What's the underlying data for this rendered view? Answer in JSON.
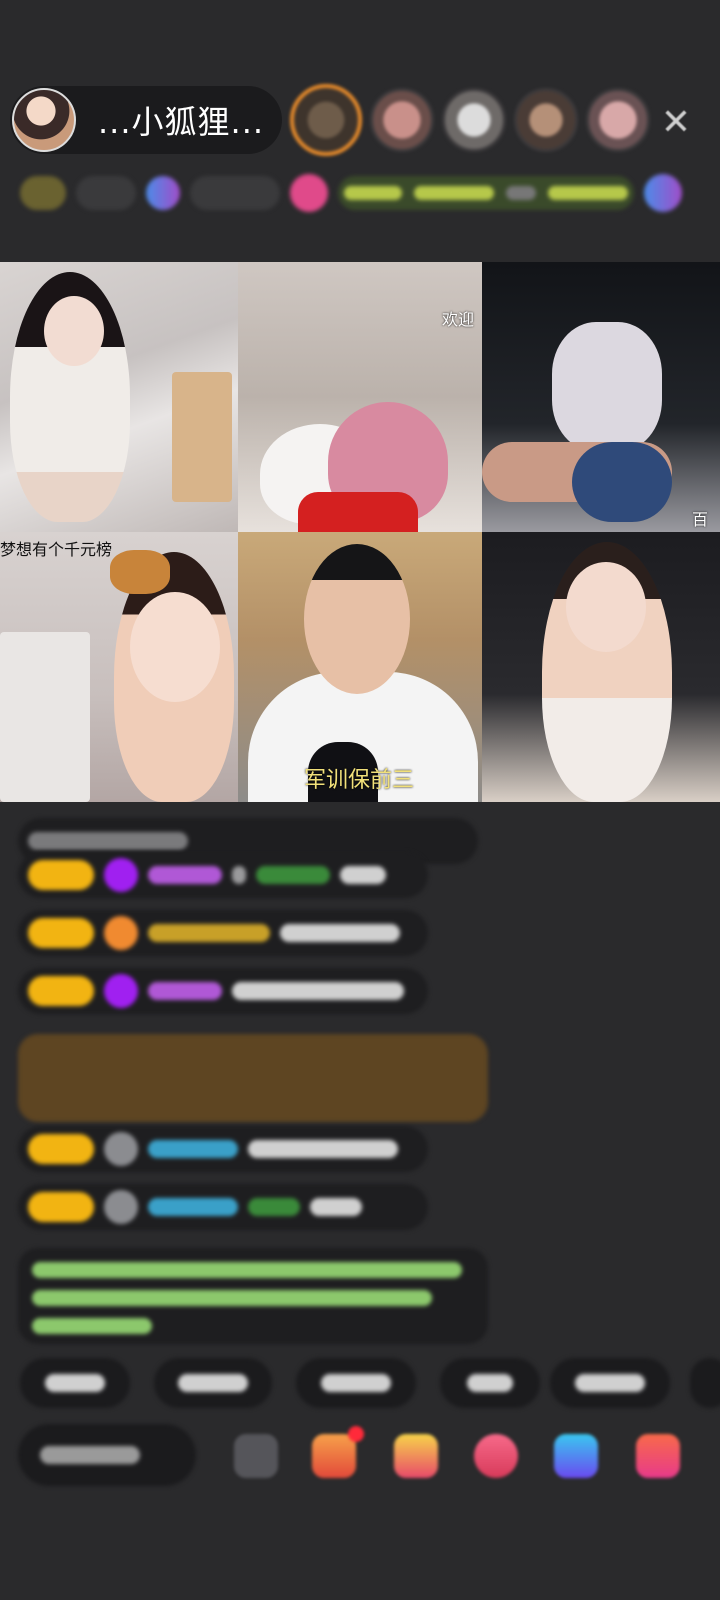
{
  "header": {
    "host_name": "...小狐狸...",
    "close_icon": "close-icon"
  },
  "grid": {
    "cells": [
      {
        "caption": ""
      },
      {
        "caption": "欢迎"
      },
      {
        "caption": "百元"
      },
      {
        "caption": "梦想有个千元榜"
      },
      {
        "caption": "军训保前三"
      },
      {
        "caption": ""
      }
    ]
  },
  "colors": {
    "background": "#2a2a2c",
    "badge_gold": "#f2b412",
    "gift_card": "#5e4522",
    "notice_text": "#8cc86c",
    "top_viewer_ring": "#e58a2b"
  }
}
